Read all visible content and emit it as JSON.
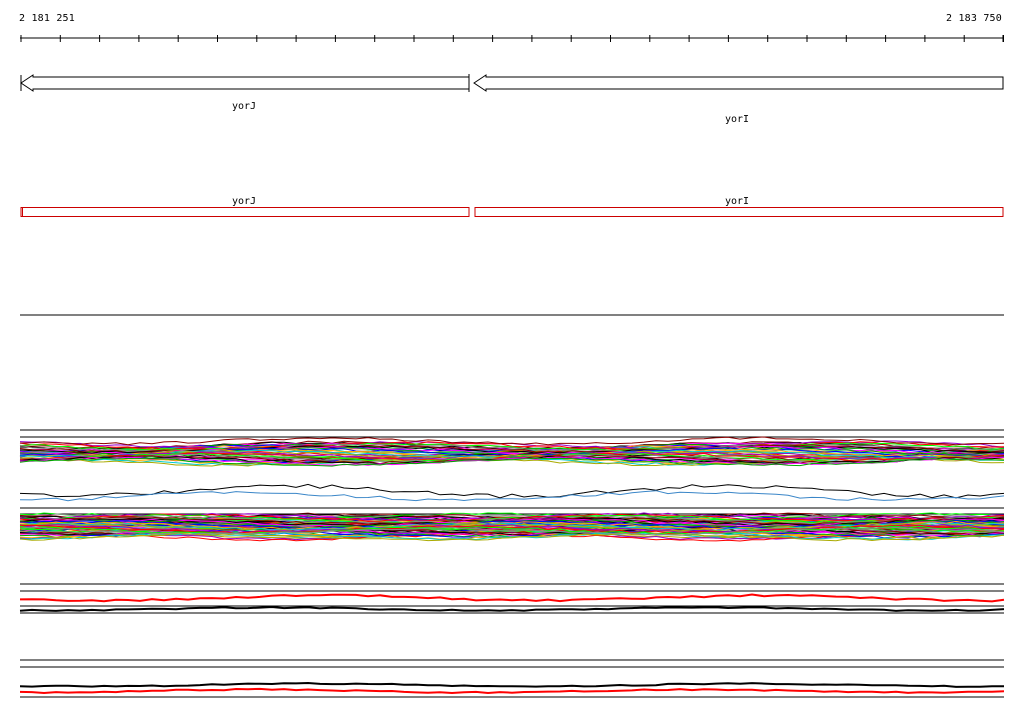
{
  "ruler": {
    "start_label": "2 181 251",
    "end_label": "2 183 750"
  },
  "genes": [
    {
      "name": "yorJ",
      "strand": "-",
      "annotation_color": "#000000"
    },
    {
      "name": "yorI",
      "strand": "-",
      "annotation_color": "#000000"
    }
  ],
  "transcripts": [
    {
      "name": "yorJ",
      "color": "#cc0000"
    },
    {
      "name": "yorI",
      "color": "#cc0000"
    }
  ],
  "tracks": {
    "profile_colors": [
      "#8b0000",
      "#000000",
      "#ff00ff",
      "#00aa00",
      "#0000ff",
      "#ffaa00",
      "#00cccc",
      "#aaaa00",
      "#9900cc",
      "#ff0000",
      "#00ff00",
      "#888888"
    ],
    "pair_colors": [
      "#000000",
      "#3a86c8"
    ],
    "highlight_color": "#ff0000"
  }
}
